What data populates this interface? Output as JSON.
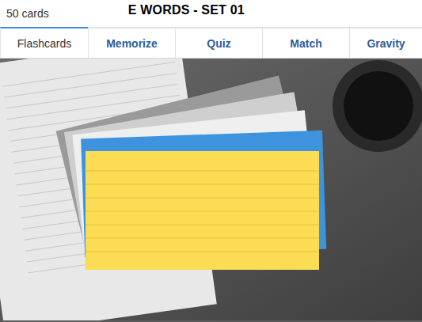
{
  "header": {
    "count": "50 cards",
    "title": "E WORDS - SET 01"
  },
  "tabs": [
    {
      "label": "Flashcards",
      "selected": true
    },
    {
      "label": "Memorize",
      "selected": false
    },
    {
      "label": "Quiz",
      "selected": false
    },
    {
      "label": "Match",
      "selected": false
    },
    {
      "label": "Gravity",
      "selected": false
    }
  ]
}
